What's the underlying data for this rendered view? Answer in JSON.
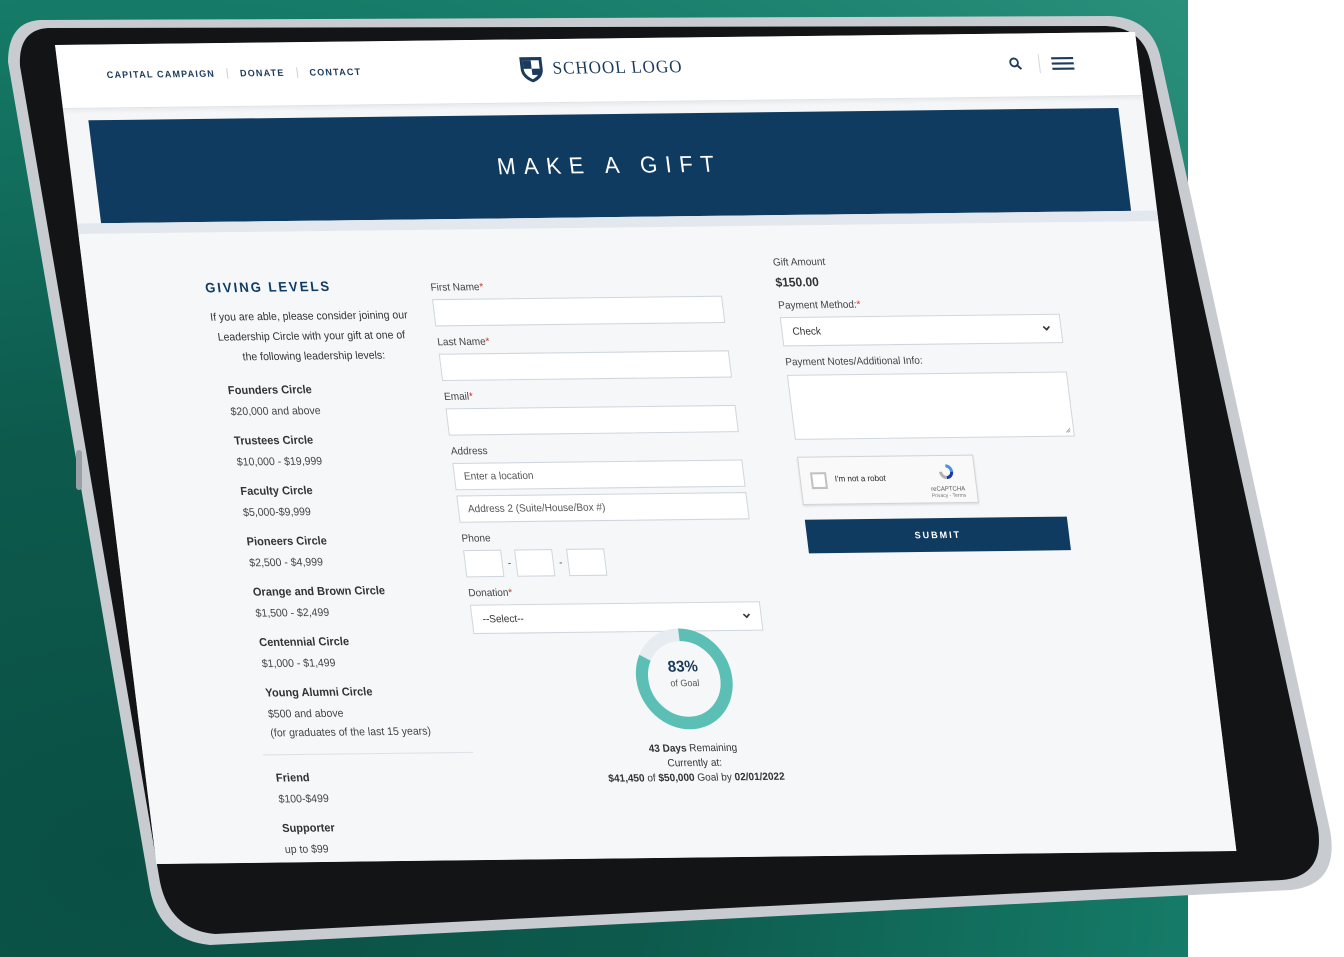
{
  "nav": {
    "links": [
      "CAPITAL CAMPAIGN",
      "DONATE",
      "CONTACT"
    ],
    "logo_text": "SCHOOL LOGO"
  },
  "hero": {
    "title": "MAKE A GIFT"
  },
  "giving": {
    "title": "GIVING LEVELS",
    "intro": "If you are able, please consider joining our Leadership Circle with your gift at one of the following leadership levels:",
    "levels": [
      {
        "name": "Founders Circle",
        "range": "$20,000 and above"
      },
      {
        "name": "Trustees Circle",
        "range": "$10,000 - $19,999"
      },
      {
        "name": "Faculty Circle",
        "range": "$5,000-$9,999"
      },
      {
        "name": "Pioneers Circle",
        "range": "$2,500 - $4,999"
      },
      {
        "name": "Orange and Brown Circle",
        "range": "$1,500 - $2,499"
      },
      {
        "name": "Centennial Circle",
        "range": "$1,000 - $1,499"
      },
      {
        "name": "Young Alumni Circle",
        "range": "$500 and above",
        "note": "(for graduates of the last 15 years)"
      },
      {
        "name": "Friend",
        "range": "$100-$499"
      },
      {
        "name": "Supporter",
        "range": "up to $99"
      }
    ]
  },
  "form": {
    "first_name_label": "First Name",
    "last_name_label": "Last Name",
    "email_label": "Email",
    "address_label": "Address",
    "address1_placeholder": "Enter a location",
    "address2_placeholder": "Address 2 (Suite/House/Box #)",
    "phone_label": "Phone",
    "phone_dash": "-",
    "donation_label": "Donation",
    "donation_value": "--Select--",
    "required_mark": "*"
  },
  "progress": {
    "percent": 83,
    "percent_label": "83%",
    "of_goal": "of Goal",
    "days_bold": "43 Days",
    "days_rest": " Remaining",
    "currently": "Currently at:",
    "raised": "$41,450",
    "of_word": " of ",
    "goal": "$50,000",
    "goal_by": " Goal by ",
    "date": "02/01/2022"
  },
  "right": {
    "gift_amount_label": "Gift Amount",
    "gift_amount": "$150.00",
    "payment_method_label": "Payment Method:",
    "payment_method_value": "Check",
    "payment_notes_label": "Payment Notes/Additional Info:",
    "captcha_text": "I'm not a robot",
    "captcha_brand": "reCAPTCHA",
    "captcha_links": "Privacy - Terms",
    "submit_label": "SUBMIT"
  },
  "colors": {
    "navy": "#0f3b61",
    "teal": "#5bbfb5",
    "background_green": "#0d5a4d",
    "required": "#c0392b"
  }
}
